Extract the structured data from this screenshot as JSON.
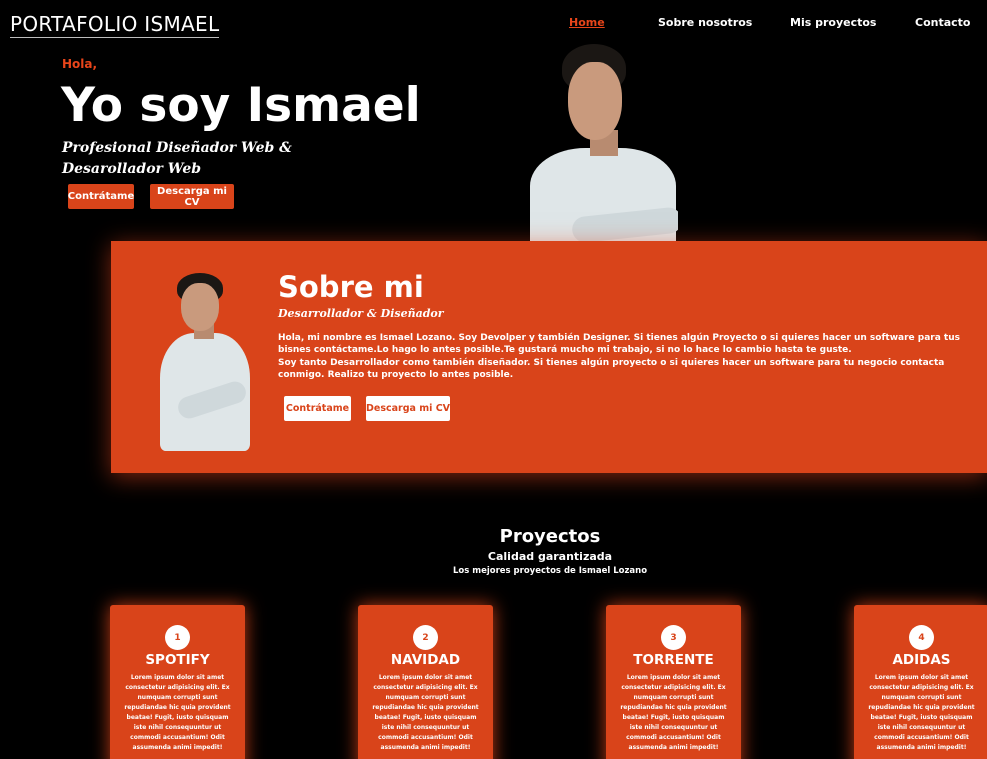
{
  "header": {
    "logo": "PORTAFOLIO ISMAEL",
    "nav": [
      "Home",
      "Sobre nosotros",
      "Mis proyectos",
      "Contacto"
    ]
  },
  "hero": {
    "greeting": "Hola,",
    "title": "Yo soy Ismael",
    "subtitle": "Profesional Diseñador Web & Desarollador Web",
    "buttons": [
      "Contrátame",
      "Descarga mi CV"
    ]
  },
  "about": {
    "title": "Sobre mi",
    "subtitle": "Desarrollador & Diseñador",
    "paragraphs": [
      "Hola, mi nombre es Ismael Lozano. Soy Devolper y también Designer. Si tienes algún Proyecto o si quieres hacer un software para tus bisnes contáctame.Lo hago lo antes posible.Te gustará mucho mi trabajo, si no lo hace lo cambio hasta te guste.",
      "Soy tanto Desarrollador como también diseñador. Si tienes algún proyecto o si quieres hacer un software para tu negocio contacta conmigo. Realizo tu proyecto lo antes posible."
    ],
    "buttons": [
      "Contrátame",
      "Descarga mi CV"
    ]
  },
  "projects": {
    "title": "Proyectos",
    "subtitle": "Calidad garantizada",
    "description": "Los mejores proyectos de Ismael Lozano",
    "cards": [
      {
        "number": "1",
        "title": "SPOTIFY",
        "text": "Lorem ipsum dolor sit amet consectetur adipisicing elit. Ex numquam corrupti sunt repudiandae hic quia provident beatae! Fugit, iusto quisquam iste nihil consequuntur ut commodi accusantium! Odit assumenda animi impedit!"
      },
      {
        "number": "2",
        "title": "NAVIDAD",
        "text": "Lorem ipsum dolor sit amet consectetur adipisicing elit. Ex numquam corrupti sunt repudiandae hic quia provident beatae! Fugit, iusto quisquam iste nihil consequuntur ut commodi accusantium! Odit assumenda animi impedit!"
      },
      {
        "number": "3",
        "title": "TORRENTE",
        "text": "Lorem ipsum dolor sit amet consectetur adipisicing elit. Ex numquam corrupti sunt repudiandae hic quia provident beatae! Fugit, iusto quisquam iste nihil consequuntur ut commodi accusantium! Odit assumenda animi impedit!"
      },
      {
        "number": "4",
        "title": "ADIDAS",
        "text": "Lorem ipsum dolor sit amet consectetur adipisicing elit. Ex numquam corrupti sunt repudiandae hic quia provident beatae! Fugit, iusto quisquam iste nihil consequuntur ut commodi accusantium! Odit assumenda animi impedit!"
      }
    ]
  },
  "colors": {
    "accent": "#d9441a",
    "background": "#000000",
    "text": "#ffffff"
  }
}
